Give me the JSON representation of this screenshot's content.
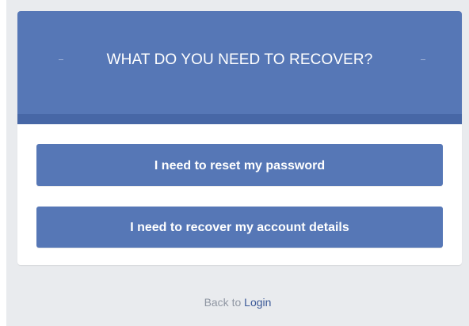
{
  "header": {
    "title": "WHAT DO YOU NEED TO RECOVER?"
  },
  "actions": {
    "reset_password_label": "I need to reset my password",
    "recover_account_label": "I need to recover my account details"
  },
  "footer": {
    "back_text": "Back to",
    "login_link": "Login"
  },
  "colors": {
    "primary": "#5677b6",
    "primary_dark": "#4767a6",
    "page_background": "#e9ebee",
    "link": "#3b5998",
    "muted_text": "#9097a3"
  }
}
